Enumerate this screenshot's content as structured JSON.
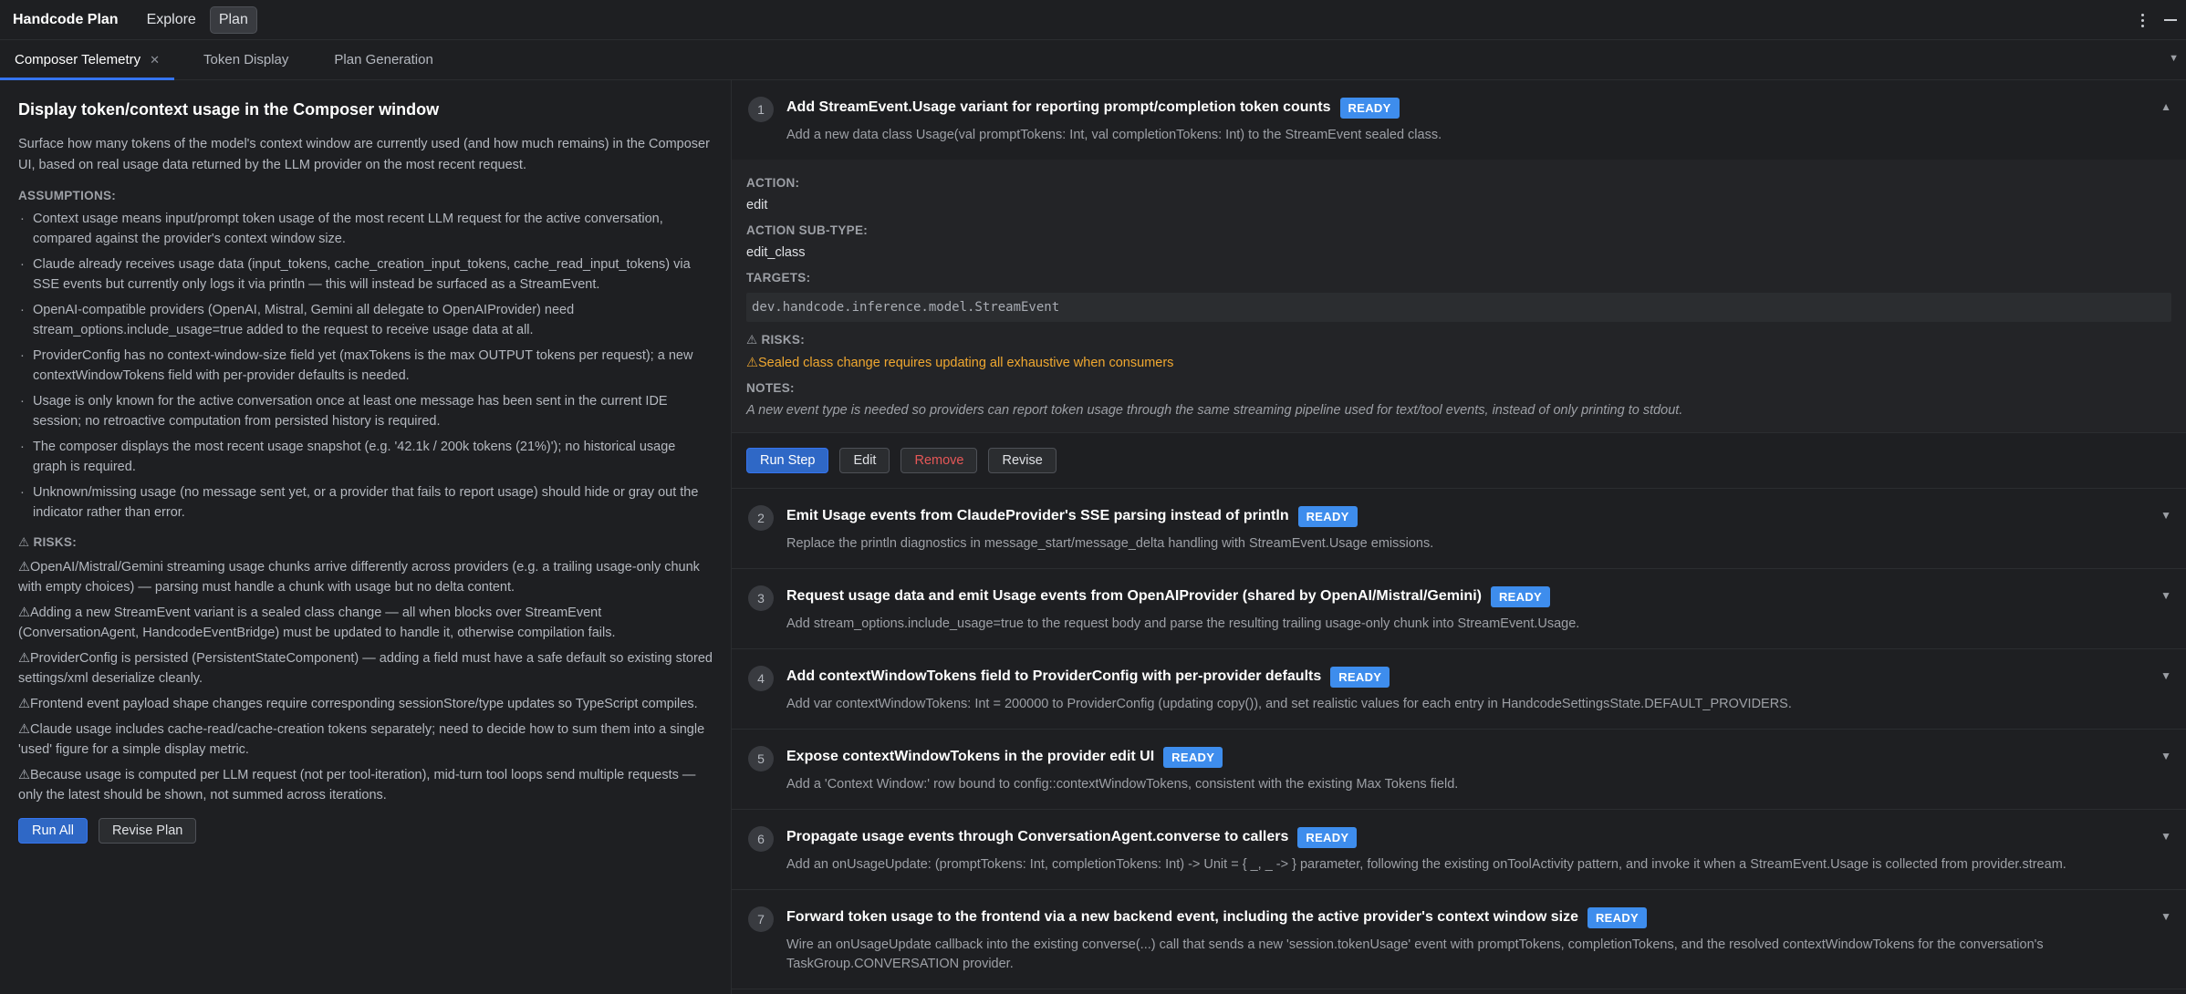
{
  "app": {
    "title": "Handcode Plan",
    "nav": [
      "Explore",
      "Plan"
    ],
    "active_nav": "Plan"
  },
  "tabs": [
    {
      "label": "Composer Telemetry",
      "active": true,
      "closable": true
    },
    {
      "label": "Token Display",
      "active": false
    },
    {
      "label": "Plan Generation",
      "active": false
    }
  ],
  "plan": {
    "title": "Display token/context usage in the Composer window",
    "summary": "Surface how many tokens of the model's context window are currently used (and how much remains) in the Composer UI, based on real usage data returned by the LLM provider on the most recent request.",
    "assumptions_heading": "ASSUMPTIONS:",
    "assumptions": [
      "Context usage means input/prompt token usage of the most recent LLM request for the active conversation, compared against the provider's context window size.",
      "Claude already receives usage data (input_tokens, cache_creation_input_tokens, cache_read_input_tokens) via SSE events but currently only logs it via println — this will instead be surfaced as a StreamEvent.",
      "OpenAI-compatible providers (OpenAI, Mistral, Gemini all delegate to OpenAIProvider) need stream_options.include_usage=true added to the request to receive usage data at all.",
      "ProviderConfig has no context-window-size field yet (maxTokens is the max OUTPUT tokens per request); a new contextWindowTokens field with per-provider defaults is needed.",
      "Usage is only known for the active conversation once at least one message has been sent in the current IDE session; no retroactive computation from persisted history is required.",
      "The composer displays the most recent usage snapshot (e.g. '42.1k / 200k tokens (21%)'); no historical usage graph is required.",
      "Unknown/missing usage (no message sent yet, or a provider that fails to report usage) should hide or gray out the indicator rather than error."
    ],
    "risks_heading": "⚠ RISKS:",
    "risks": [
      "⚠OpenAI/Mistral/Gemini streaming usage chunks arrive differently across providers (e.g. a trailing usage-only chunk with empty choices) — parsing must handle a chunk with usage but no delta content.",
      "⚠Adding a new StreamEvent variant is a sealed class change — all when blocks over StreamEvent (ConversationAgent, HandcodeEventBridge) must be updated to handle it, otherwise compilation fails.",
      "⚠ProviderConfig is persisted (PersistentStateComponent) — adding a field must have a safe default so existing stored settings/xml deserialize cleanly.",
      "⚠Frontend event payload shape changes require corresponding sessionStore/type updates so TypeScript compiles.",
      "⚠Claude usage includes cache-read/cache-creation tokens separately; need to decide how to sum them into a single 'used' figure for a simple display metric.",
      "⚠Because usage is computed per LLM request (not per tool-iteration), mid-turn tool loops send multiple requests — only the latest should be shown, not summed across iterations."
    ],
    "run_all_label": "Run All",
    "revise_plan_label": "Revise Plan"
  },
  "step_detail": {
    "action_label": "ACTION:",
    "action_value": "edit",
    "subtype_label": "ACTION SUB-TYPE:",
    "subtype_value": "edit_class",
    "targets_label": "TARGETS:",
    "targets_value": "dev.handcode.inference.model.StreamEvent",
    "risks_label": "⚠ RISKS:",
    "risks_value": "⚠Sealed class change requires updating all exhaustive when consumers",
    "notes_label": "NOTES:",
    "notes_value": "A new event type is needed so providers can report token usage through the same streaming pipeline used for text/tool events, instead of only printing to stdout.",
    "buttons": {
      "run": "Run Step",
      "edit": "Edit",
      "remove": "Remove",
      "revise": "Revise"
    }
  },
  "steps": [
    {
      "num": "1",
      "title": "Add StreamEvent.Usage variant for reporting prompt/completion token counts",
      "badge": "READY",
      "desc": "Add a new data class Usage(val promptTokens: Int, val completionTokens: Int) to the StreamEvent sealed class.",
      "expanded": true
    },
    {
      "num": "2",
      "title": "Emit Usage events from ClaudeProvider's SSE parsing instead of println",
      "badge": "READY",
      "desc": "Replace the println diagnostics in message_start/message_delta handling with StreamEvent.Usage emissions."
    },
    {
      "num": "3",
      "title": "Request usage data and emit Usage events from OpenAIProvider (shared by OpenAI/Mistral/Gemini)",
      "badge": "READY",
      "desc": "Add stream_options.include_usage=true to the request body and parse the resulting trailing usage-only chunk into StreamEvent.Usage."
    },
    {
      "num": "4",
      "title": "Add contextWindowTokens field to ProviderConfig with per-provider defaults",
      "badge": "READY",
      "desc": "Add var contextWindowTokens: Int = 200000 to ProviderConfig (updating copy()), and set realistic values for each entry in HandcodeSettingsState.DEFAULT_PROVIDERS."
    },
    {
      "num": "5",
      "title": "Expose contextWindowTokens in the provider edit UI",
      "badge": "READY",
      "desc": "Add a 'Context Window:' row bound to config::contextWindowTokens, consistent with the existing Max Tokens field."
    },
    {
      "num": "6",
      "title": "Propagate usage events through ConversationAgent.converse to callers",
      "badge": "READY",
      "desc": "Add an onUsageUpdate: (promptTokens: Int, completionTokens: Int) -> Unit = { _, _ -> } parameter, following the existing onToolActivity pattern, and invoke it when a StreamEvent.Usage is collected from provider.stream."
    },
    {
      "num": "7",
      "title": "Forward token usage to the frontend via a new backend event, including the active provider's context window size",
      "badge": "READY",
      "desc": "Wire an onUsageUpdate callback into the existing converse(...) call that sends a new 'session.tokenUsage' event with promptTokens, completionTokens, and the resolved contextWindowTokens for the conversation's TaskGroup.CONVERSATION provider."
    }
  ]
}
